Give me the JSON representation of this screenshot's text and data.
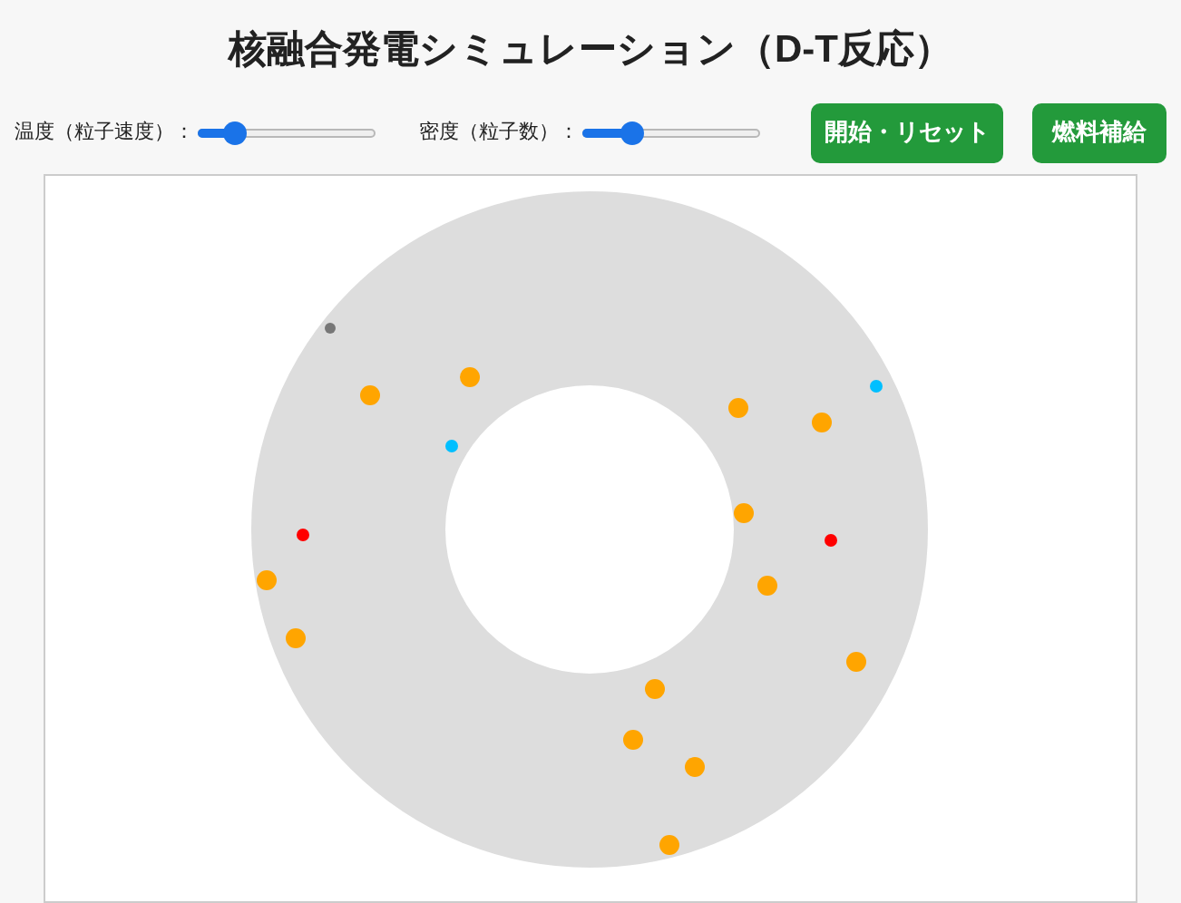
{
  "title": "核融合発電シミュレーション（D-T反応）",
  "controls": [
    {
      "label": "温度（粒子速度）：",
      "level": 0.2
    },
    {
      "label": "密度（粒子数）：",
      "level": 0.28
    }
  ],
  "buttons": [
    "開始・リセット",
    "燃料補給"
  ]
}
